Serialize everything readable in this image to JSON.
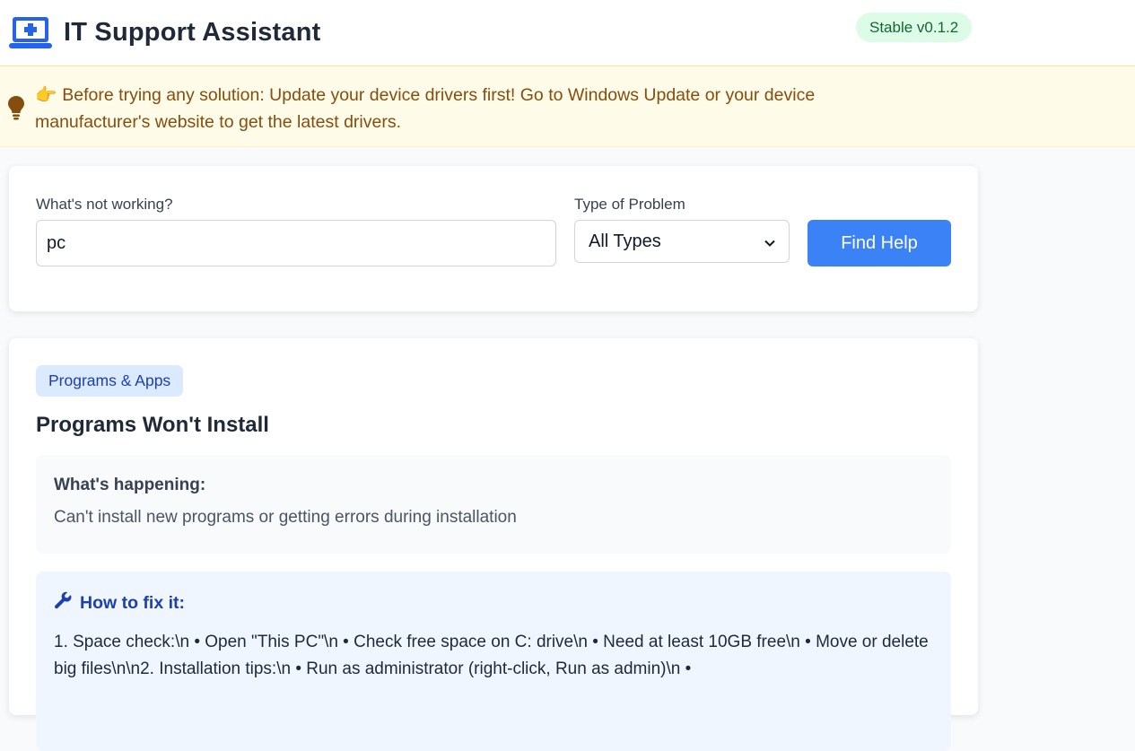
{
  "header": {
    "title": "IT Support Assistant",
    "version": "Stable v0.1.2",
    "logo_icon": "laptop-medical-icon",
    "accent": "#2563eb"
  },
  "banner": {
    "icon": "lightbulb-icon",
    "emoji": "👉",
    "text": "Before trying any solution: Update your device drivers first! Go to Windows Update or your device manufacturer's website to get the latest drivers."
  },
  "search": {
    "problem_label": "What's not working?",
    "problem_value": "pc",
    "type_label": "Type of Problem",
    "type_selected": "All Types",
    "button_label": "Find Help",
    "button_color": "#3b82f6"
  },
  "result": {
    "category": "Programs & Apps",
    "title": "Programs Won't Install",
    "happening_heading": "What's happening:",
    "happening_text": "Can't install new programs or getting errors during installation",
    "fix_heading": "How to fix it:",
    "fix_icon": "wrench-icon",
    "fix_text": "1. Space check:\\n • Open \"This PC\"\\n • Check free space on C: drive\\n • Need at least 10GB free\\n • Move or delete big files\\n\\n2. Installation tips:\\n • Run as administrator (right-click, Run as admin)\\n •"
  }
}
